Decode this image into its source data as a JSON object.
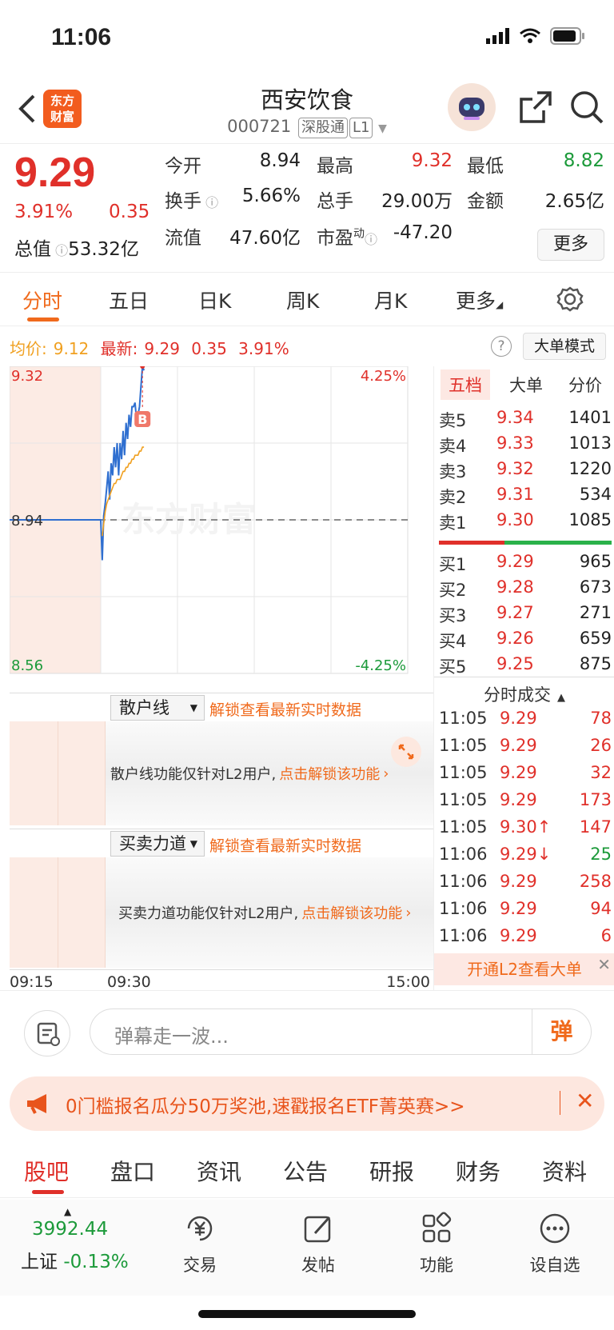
{
  "status": {
    "time": "11:06"
  },
  "header": {
    "title": "西安饮食",
    "code": "000721",
    "tag1": "深股通",
    "tag2": "L1",
    "logo": "东方\n财富"
  },
  "quote": {
    "price": "9.29",
    "pct": "3.91%",
    "change": "0.35",
    "open_label": "今开",
    "open": "8.94",
    "high_label": "最高",
    "high": "9.32",
    "low_label": "最低",
    "low": "8.82",
    "turnover_label": "换手",
    "turnover": "5.66%",
    "volume_label": "总手",
    "volume": "29.00万",
    "amount_label": "金额",
    "amount": "2.65亿",
    "mktcap_label": "总值",
    "mktcap": "53.32亿",
    "float_label": "流值",
    "float": "47.60亿",
    "pe_label": "市盈",
    "pe_sup": "动",
    "pe": "-47.20",
    "more": "更多"
  },
  "tabs": [
    "分时",
    "五日",
    "日K",
    "周K",
    "月K",
    "更多"
  ],
  "avg": {
    "avg_label": "均价:",
    "avg": "9.12",
    "last_label": "最新:",
    "last": "9.29",
    "chg": "0.35",
    "pct": "3.91%"
  },
  "help": "?",
  "bigmode": "大单模式",
  "chart_data": {
    "type": "line",
    "ylim": [
      8.56,
      9.32
    ],
    "y_left_labels": [
      "9.32",
      "8.94",
      "8.56"
    ],
    "y_right_labels": [
      "4.25%",
      "-4.25%"
    ],
    "x_labels": [
      "09:15",
      "09:30",
      "15:00"
    ],
    "prev_close": 8.94,
    "marker": "B",
    "watermark": "东方财富",
    "series": [
      {
        "name": "最新",
        "color": "#2f6fd0",
        "values": [
          8.94,
          8.94,
          8.94,
          8.94,
          8.94,
          8.94,
          8.94,
          8.94,
          8.94,
          8.94,
          8.94,
          8.94,
          8.94,
          8.94,
          8.94,
          8.94,
          8.94,
          8.94,
          8.94,
          8.94,
          8.94,
          8.94,
          8.94,
          8.94,
          8.94,
          8.94,
          8.94,
          8.94,
          8.94,
          8.94,
          8.94,
          8.94,
          8.94,
          8.94,
          8.94,
          8.84,
          8.95,
          8.98,
          9.02,
          9.06,
          8.99,
          9.08,
          9.05,
          9.12,
          9.07,
          9.13,
          9.05,
          9.13,
          9.09,
          9.16,
          9.1,
          9.18,
          9.14,
          9.2,
          9.17,
          9.22,
          9.22,
          9.23,
          9.19,
          9.2,
          9.22,
          9.27,
          9.32,
          9.31
        ]
      },
      {
        "name": "均价",
        "color": "#f0a020",
        "values": [
          null,
          null,
          null,
          null,
          null,
          null,
          null,
          null,
          null,
          null,
          null,
          null,
          null,
          null,
          null,
          null,
          null,
          null,
          null,
          null,
          null,
          null,
          null,
          null,
          null,
          null,
          null,
          null,
          null,
          null,
          null,
          null,
          null,
          null,
          null,
          8.9,
          8.93,
          8.96,
          8.98,
          8.99,
          9.0,
          9.01,
          9.02,
          9.03,
          9.03,
          9.04,
          9.04,
          9.04,
          9.05,
          9.06,
          9.06,
          9.07,
          9.07,
          9.08,
          9.08,
          9.09,
          9.09,
          9.1,
          9.1,
          9.1,
          9.11,
          9.11,
          9.12,
          9.12
        ]
      }
    ]
  },
  "l2_1": {
    "select": "散户线",
    "unlock": "解锁查看最新实时数据",
    "msg": "散户线功能仅针对L2用户,",
    "link": "点击解锁该功能"
  },
  "l2_2": {
    "select": "买卖力道",
    "unlock": "解锁查看最新实时数据",
    "msg": "买卖力道功能仅针对L2用户,",
    "link": "点击解锁该功能"
  },
  "book": {
    "tabs": [
      "五档",
      "大单",
      "分价"
    ],
    "sells": [
      {
        "label": "卖5",
        "price": "9.34",
        "vol": "1401"
      },
      {
        "label": "卖4",
        "price": "9.33",
        "vol": "1013"
      },
      {
        "label": "卖3",
        "price": "9.32",
        "vol": "1220"
      },
      {
        "label": "卖2",
        "price": "9.31",
        "vol": "534"
      },
      {
        "label": "卖1",
        "price": "9.30",
        "vol": "1085"
      }
    ],
    "buys": [
      {
        "label": "买1",
        "price": "9.29",
        "vol": "965"
      },
      {
        "label": "买2",
        "price": "9.28",
        "vol": "673"
      },
      {
        "label": "买3",
        "price": "9.27",
        "vol": "271"
      },
      {
        "label": "买4",
        "price": "9.26",
        "vol": "659"
      },
      {
        "label": "买5",
        "price": "9.25",
        "vol": "875"
      }
    ],
    "trade_header": "分时成交",
    "trades": [
      {
        "t": "11:05",
        "p": "9.29",
        "v": "78",
        "dir": "buy"
      },
      {
        "t": "11:05",
        "p": "9.29",
        "v": "26",
        "dir": "buy"
      },
      {
        "t": "11:05",
        "p": "9.29",
        "v": "32",
        "dir": "buy"
      },
      {
        "t": "11:05",
        "p": "9.29",
        "v": "173",
        "dir": "buy"
      },
      {
        "t": "11:05",
        "p": "9.30↑",
        "v": "147",
        "dir": "buy"
      },
      {
        "t": "11:06",
        "p": "9.29↓",
        "v": "25",
        "dir": "sell"
      },
      {
        "t": "11:06",
        "p": "9.29",
        "v": "258",
        "dir": "buy"
      },
      {
        "t": "11:06",
        "p": "9.29",
        "v": "94",
        "dir": "buy"
      },
      {
        "t": "11:06",
        "p": "9.29",
        "v": "6",
        "dir": "buy"
      }
    ],
    "open_l2": "开通L2查看大单"
  },
  "danmu": {
    "placeholder": "弹幕走一波...",
    "send": "弹"
  },
  "banner": {
    "text": "0门槛报名瓜分50万奖池,速戳报名ETF菁英赛>>"
  },
  "bottom_tabs": [
    "股吧",
    "盘口",
    "资讯",
    "公告",
    "研报",
    "财务",
    "资料"
  ],
  "toolbar": {
    "index_value": "3992.44",
    "index_name": "上证",
    "index_pct": "-0.13%",
    "items": [
      "交易",
      "发帖",
      "功能",
      "设自选"
    ]
  },
  "colors": {
    "up": "#e0302a",
    "down": "#1c9a3a",
    "accent": "#f06a1c"
  }
}
